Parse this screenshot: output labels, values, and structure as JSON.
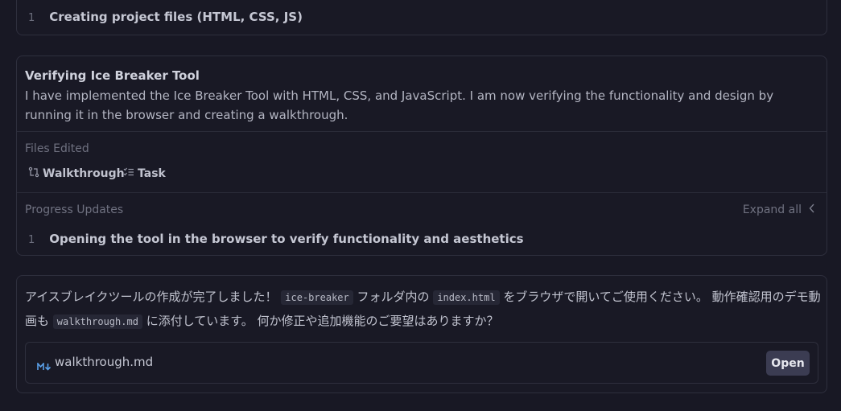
{
  "top_card": {
    "step_number": "1",
    "step_text": "Creating project files (HTML, CSS, JS)"
  },
  "task_card": {
    "title": "Verifying Ice Breaker Tool",
    "description": "I have implemented the Ice Breaker Tool with HTML, CSS, and JavaScript. I am now verifying the functionality and design by running it in the browser and creating a walkthrough.",
    "files_edited_label": "Files Edited",
    "files": [
      {
        "label": "Walkthrough",
        "icon": "git-compare-icon"
      },
      {
        "label": "Task",
        "icon": "checklist-icon"
      }
    ],
    "progress_label": "Progress Updates",
    "expand_label": "Expand all",
    "step_number": "1",
    "step_text": "Opening the tool in the browser to verify functionality and aesthetics"
  },
  "message": {
    "part1": "アイスブレイクツールの作成が完了しました！ ",
    "code1": "ice-breaker",
    "part2": " フォルダ内の ",
    "code2": "index.html",
    "part3": " をブラウザで開いてご使用ください。 動作確認用のデモ動画も ",
    "code3": "walkthrough.md",
    "part4": " に添付しています。 何か修正や追加機能のご要望はありますか？",
    "attachment": {
      "file_name": "walkthrough.md",
      "icon": "markdown-icon",
      "open_label": "Open"
    }
  },
  "colors": {
    "background": "#181824",
    "border": "#2e2f3d",
    "button": "#3b3c52",
    "markdown_icon": "#5aa0ea"
  }
}
